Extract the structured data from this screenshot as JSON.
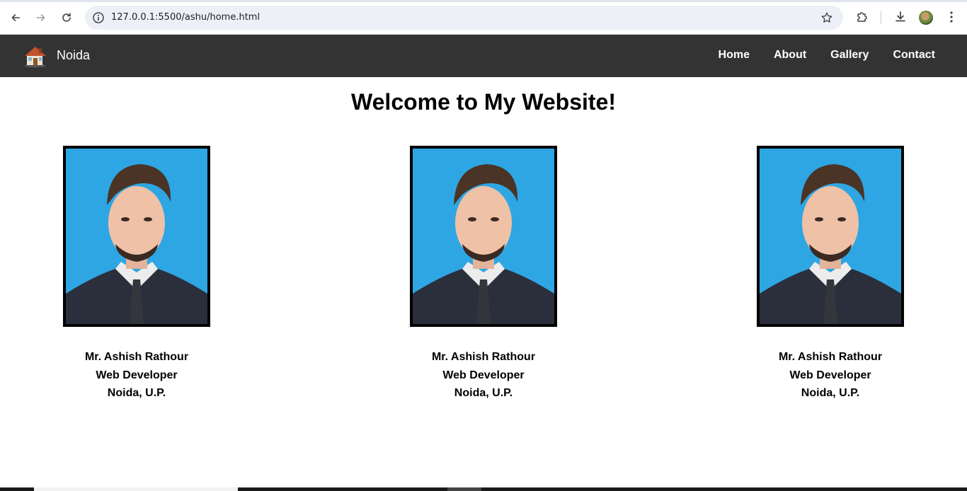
{
  "browser": {
    "url": "127.0.0.1:5500/ashu/home.html",
    "icons": [
      "back-icon",
      "forward-icon",
      "reload-icon",
      "site-info-icon",
      "bookmark-star-icon",
      "extensions-icon",
      "download-icon",
      "profile-avatar",
      "menu-kebab-icon"
    ]
  },
  "navbar": {
    "brand": "Noida",
    "links": [
      "Home",
      "About",
      "Gallery",
      "Contact"
    ],
    "background": "#333333"
  },
  "main": {
    "title": "Welcome to My Website!",
    "cards": [
      {
        "name": "Mr. Ashish Rathour",
        "role": "Web Developer",
        "location": "Noida, U.P."
      },
      {
        "name": "Mr. Ashish Rathour",
        "role": "Web Developer",
        "location": "Noida, U.P."
      },
      {
        "name": "Mr. Ashish Rathour",
        "role": "Web Developer",
        "location": "Noida, U.P."
      }
    ],
    "photo_background": "#2ea6e3"
  }
}
